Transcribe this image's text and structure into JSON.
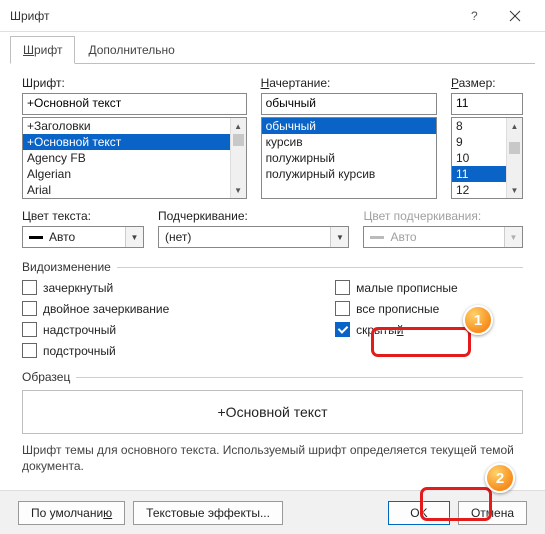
{
  "window": {
    "title": "Шрифт"
  },
  "tabs": {
    "t1": "Шрифт",
    "t1_u": "Ш",
    "t2": "Дополнительно",
    "t2_u": "Д"
  },
  "font": {
    "label": "Шрифт:",
    "value": "+Основной текст",
    "items": {
      "i0": "+Заголовки",
      "i1": "+Основной текст",
      "i2": "Agency FB",
      "i3": "Algerian",
      "i4": "Arial"
    }
  },
  "style": {
    "label": "Начертание:",
    "label_u": "Н",
    "value": "обычный",
    "items": {
      "i0": "обычный",
      "i1": "курсив",
      "i2": "полужирный",
      "i3": "полужирный курсив"
    }
  },
  "size": {
    "label": "Размер:",
    "label_u": "Р",
    "value": "11",
    "items": {
      "i0": "8",
      "i1": "9",
      "i2": "10",
      "i3": "11",
      "i4": "12"
    }
  },
  "color": {
    "label": "Цвет текста:",
    "value": "Авто"
  },
  "underline": {
    "label": "Подчеркивание:",
    "value": "(нет)"
  },
  "ucolor": {
    "label": "Цвет подчеркивания:",
    "value": "Авто"
  },
  "group_effects": "Видоизменение",
  "effects": {
    "left": {
      "e0": "зачеркнутый",
      "e1": "двойное зачеркивание",
      "e2": "надстрочный",
      "e3": "подстрочный"
    },
    "right": {
      "e0": "малые прописные",
      "e1": "все прописные",
      "e2": "скрытый",
      "e2_u": "й"
    }
  },
  "group_sample": "Образец",
  "sample": "+Основной текст",
  "desc": "Шрифт темы для основного текста. Используемый шрифт определяется текущей темой документа.",
  "buttons": {
    "default": "По умолчанию",
    "default_u": "ю",
    "effects": "Текстовые эффекты...",
    "ok": "OK",
    "cancel": "Отмена"
  },
  "badges": {
    "b1": "1",
    "b2": "2"
  }
}
